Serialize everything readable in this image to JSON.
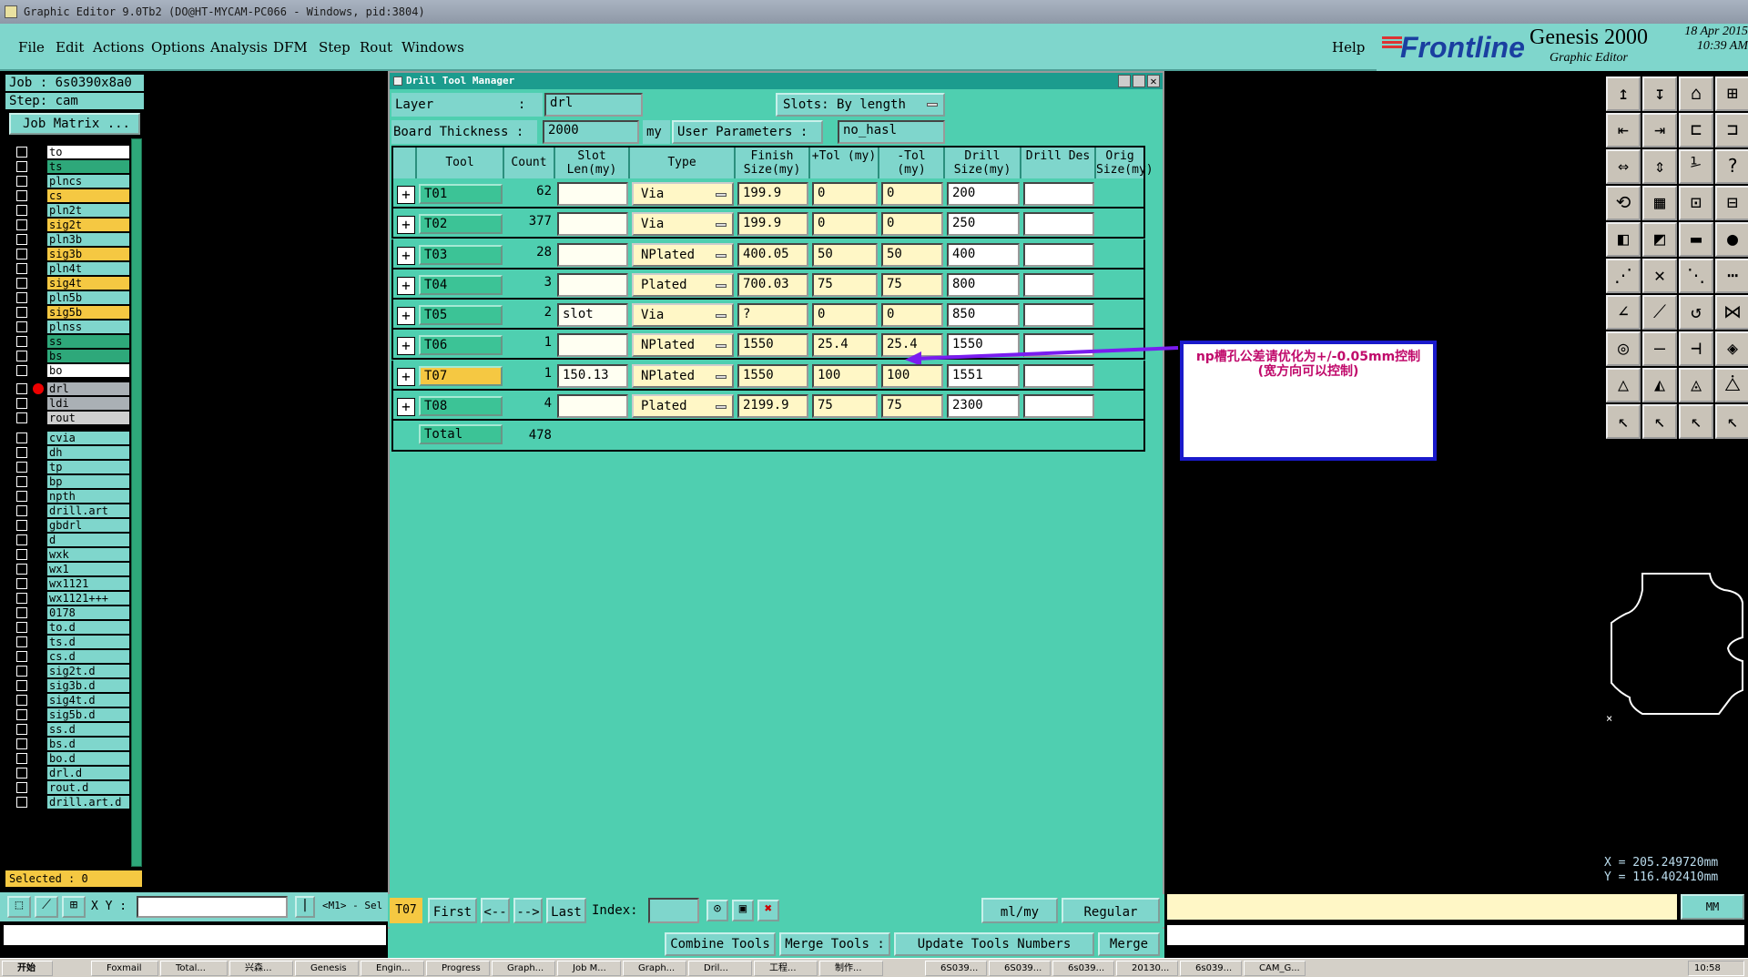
{
  "window": {
    "title": "Graphic Editor 9.0Tb2 (DO@HT-MYCAM-PC066 - Windows, pid:3804)"
  },
  "menu": [
    "File",
    "Edit",
    "Actions",
    "Options",
    "Analysis",
    "DFM",
    "Step",
    "Rout",
    "Windows"
  ],
  "help": "Help",
  "brand": {
    "logo": "Frontline",
    "product": "Genesis 2000",
    "sub": "Graphic Editor",
    "date": "18 Apr 2015",
    "time": "10:39 AM"
  },
  "job": {
    "job": "Job  : 6s0390x8a0",
    "step": "Step: cam",
    "matrix_btn": "Job Matrix ..."
  },
  "layers": [
    {
      "name": "to",
      "bg": "#ffffff"
    },
    {
      "name": "ts",
      "bg": "#2ea87a"
    },
    {
      "name": "plncs",
      "bg": "#7fd6cc"
    },
    {
      "name": "cs",
      "bg": "#f5c842"
    },
    {
      "name": "pln2t",
      "bg": "#7fd6cc"
    },
    {
      "name": "sig2t",
      "bg": "#f5c842"
    },
    {
      "name": "pln3b",
      "bg": "#7fd6cc"
    },
    {
      "name": "sig3b",
      "bg": "#f5c842"
    },
    {
      "name": "pln4t",
      "bg": "#7fd6cc"
    },
    {
      "name": "sig4t",
      "bg": "#f5c842"
    },
    {
      "name": "pln5b",
      "bg": "#7fd6cc"
    },
    {
      "name": "sig5b",
      "bg": "#f5c842"
    },
    {
      "name": "plnss",
      "bg": "#7fd6cc"
    },
    {
      "name": "ss",
      "bg": "#2ea87a"
    },
    {
      "name": "bs",
      "bg": "#2ea87a"
    },
    {
      "name": "bo",
      "bg": "#ffffff"
    },
    {
      "name": "drl",
      "bg": "#aab0b5"
    },
    {
      "name": "ldi",
      "bg": "#aab0b5"
    },
    {
      "name": "rout",
      "bg": "#cfcfcf"
    },
    {
      "name": "cvia",
      "bg": "#7fd6cc"
    },
    {
      "name": "dh",
      "bg": "#7fd6cc"
    },
    {
      "name": "tp",
      "bg": "#7fd6cc"
    },
    {
      "name": "bp",
      "bg": "#7fd6cc"
    },
    {
      "name": "npth",
      "bg": "#7fd6cc"
    },
    {
      "name": "drill.art",
      "bg": "#7fd6cc"
    },
    {
      "name": "gbdrl",
      "bg": "#7fd6cc"
    },
    {
      "name": "d",
      "bg": "#7fd6cc"
    },
    {
      "name": "wxk",
      "bg": "#7fd6cc"
    },
    {
      "name": "wx1",
      "bg": "#7fd6cc"
    },
    {
      "name": "wx1121",
      "bg": "#7fd6cc"
    },
    {
      "name": "wx1121+++",
      "bg": "#7fd6cc"
    },
    {
      "name": "0178",
      "bg": "#7fd6cc"
    },
    {
      "name": "to.d",
      "bg": "#7fd6cc"
    },
    {
      "name": "ts.d",
      "bg": "#7fd6cc"
    },
    {
      "name": "cs.d",
      "bg": "#7fd6cc"
    },
    {
      "name": "sig2t.d",
      "bg": "#7fd6cc"
    },
    {
      "name": "sig3b.d",
      "bg": "#7fd6cc"
    },
    {
      "name": "sig4t.d",
      "bg": "#7fd6cc"
    },
    {
      "name": "sig5b.d",
      "bg": "#7fd6cc"
    },
    {
      "name": "ss.d",
      "bg": "#7fd6cc"
    },
    {
      "name": "bs.d",
      "bg": "#7fd6cc"
    },
    {
      "name": "bo.d",
      "bg": "#7fd6cc"
    },
    {
      "name": "drl.d",
      "bg": "#7fd6cc"
    },
    {
      "name": "rout.d",
      "bg": "#7fd6cc"
    },
    {
      "name": "drill.art.d",
      "bg": "#7fd6cc"
    }
  ],
  "selected": "Selected : 0",
  "xy_label": "X Y :",
  "m1_label": "<M1> - Sel",
  "dtm": {
    "title": "Drill Tool Manager",
    "layer_label": "Layer           :",
    "layer_value": "drl",
    "slots_label": "Slots:",
    "slots_value": "By length",
    "board_label": "Board Thickness :",
    "board_value": "2000",
    "board_unit": "my",
    "userparam_label": "User Parameters :",
    "userparam_value": "no_hasl",
    "headers": [
      "Tool",
      "Count",
      "Slot Len(my)",
      "Type",
      "Finish Size(my)",
      "+Tol (my)",
      "-Tol (my)",
      "Drill Size(my)",
      "Drill Des",
      "Orig Size(my)"
    ],
    "rows": [
      {
        "tool": "T01",
        "count": "62",
        "slot": "",
        "type": "Via",
        "finish": "199.9",
        "ptol": "0",
        "mtol": "0",
        "drill": "200",
        "des": ""
      },
      {
        "tool": "T02",
        "count": "377",
        "slot": "",
        "type": "Via",
        "finish": "199.9",
        "ptol": "0",
        "mtol": "0",
        "drill": "250",
        "des": ""
      },
      {
        "tool": "T03",
        "count": "28",
        "slot": "",
        "type": "NPlated",
        "finish": "400.05",
        "ptol": "50",
        "mtol": "50",
        "drill": "400",
        "des": ""
      },
      {
        "tool": "T04",
        "count": "3",
        "slot": "",
        "type": "Plated",
        "finish": "700.03",
        "ptol": "75",
        "mtol": "75",
        "drill": "800",
        "des": ""
      },
      {
        "tool": "T05",
        "count": "2",
        "slot": "slot",
        "type": "Via",
        "finish": "?",
        "ptol": "0",
        "mtol": "0",
        "drill": "850",
        "des": ""
      },
      {
        "tool": "T06",
        "count": "1",
        "slot": "",
        "type": "NPlated",
        "finish": "1550",
        "ptol": "25.4",
        "mtol": "25.4",
        "drill": "1550",
        "des": ""
      },
      {
        "tool": "T07",
        "count": "1",
        "slot": "150.13",
        "type": "NPlated",
        "finish": "1550",
        "ptol": "100",
        "mtol": "100",
        "drill": "1551",
        "des": ""
      },
      {
        "tool": "T08",
        "count": "4",
        "slot": "",
        "type": "Plated",
        "finish": "2199.9",
        "ptol": "75",
        "mtol": "75",
        "drill": "2300",
        "des": ""
      }
    ],
    "total_label": "Total",
    "total_value": "478",
    "current_tool": "T07",
    "nav": {
      "first": "First",
      "prev": "<--",
      "next": "-->",
      "last": "Last",
      "index": "Index:",
      "units": "ml/my",
      "mode": "Regular"
    },
    "actions": {
      "combine": "Combine Tools",
      "merge_nums": "Merge Tools :",
      "update": "Update Tools Numbers",
      "merge": "Merge"
    }
  },
  "annotation": {
    "line1": "np槽孔公差请优化为+/-0.05mm控制",
    "line2": "(宽方向可以控制)"
  },
  "coords": {
    "x": "X =  205.249720mm",
    "y": "Y =  116.402410mm"
  },
  "units_btn": "MM",
  "taskbar": {
    "start": "开始",
    "items": [
      "Foxmail",
      "Total...",
      "兴森...",
      "Genesis",
      "Engin...",
      "Progress",
      "Graph...",
      "Job M...",
      "Graph...",
      "Dril...",
      "工程...",
      "制作...",
      "6S039...",
      "6S039...",
      "6s039...",
      "20130...",
      "6s039...",
      "CAM_G..."
    ],
    "clock": "10:58"
  }
}
